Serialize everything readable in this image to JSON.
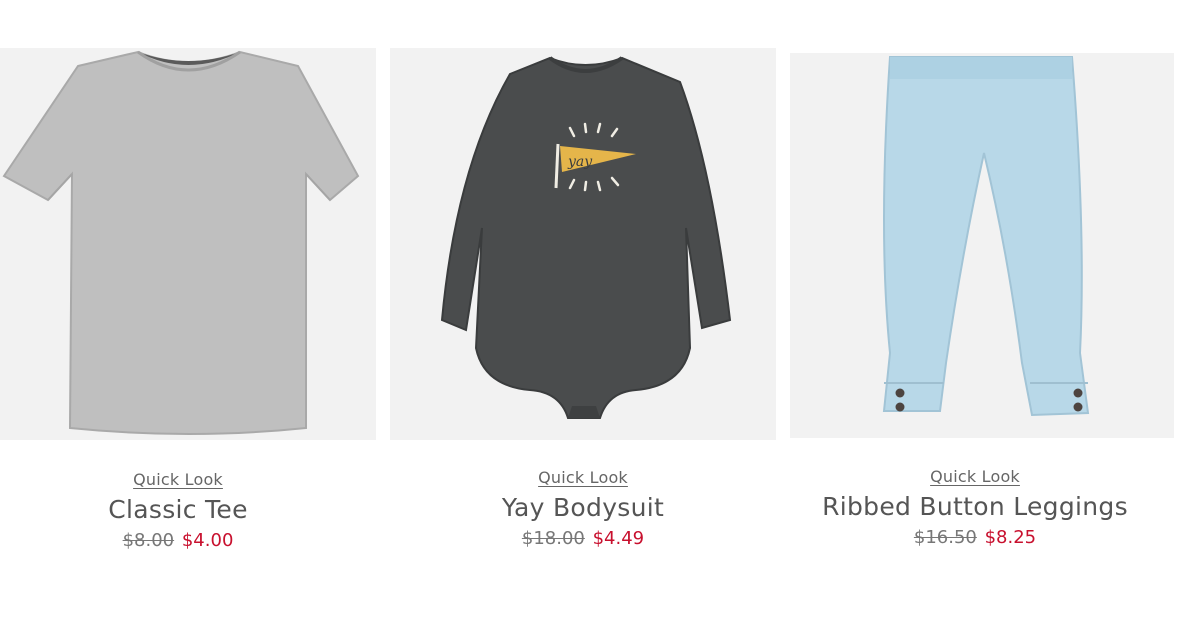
{
  "products": [
    {
      "quick_look": "Quick Look",
      "name": "Classic Tee",
      "original_price": "$8.00",
      "sale_price": "$4.00",
      "image_icon": "gray-tshirt-image"
    },
    {
      "quick_look": "Quick Look",
      "name": "Yay Bodysuit",
      "original_price": "$18.00",
      "sale_price": "$4.49",
      "image_icon": "charcoal-bodysuit-image",
      "graphic_text": "yay"
    },
    {
      "quick_look": "Quick Look",
      "name": "Ribbed Button Leggings",
      "original_price": "$16.50",
      "sale_price": "$8.25",
      "image_icon": "light-blue-leggings-image"
    }
  ],
  "colors": {
    "sale_price": "#c8102e",
    "original_price": "#777777",
    "name_text": "#555555",
    "image_bg": "#f2f2f2",
    "tee": "#bdbdbd",
    "bodysuit": "#4a4c4d",
    "leggings": "#b8d8e8",
    "pennant": "#e5b54a"
  }
}
